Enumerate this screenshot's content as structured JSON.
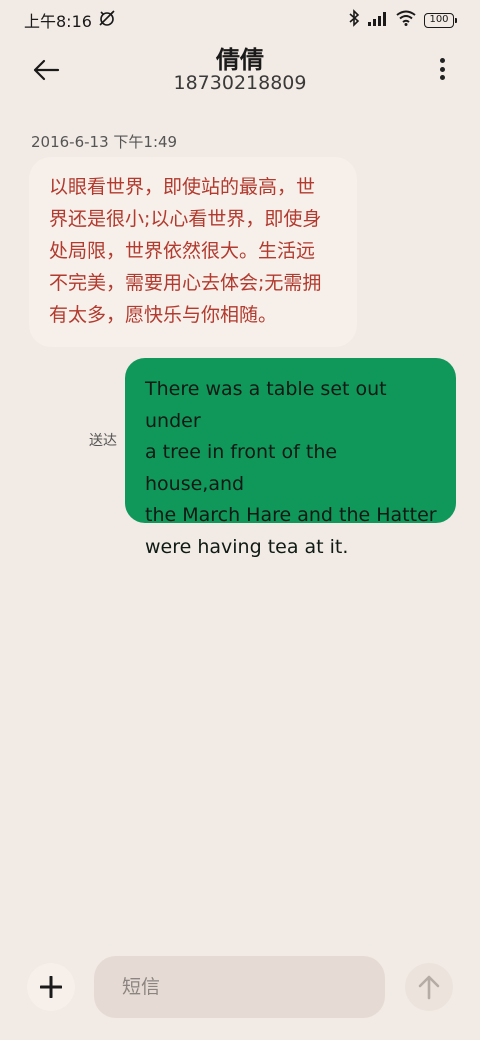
{
  "status_bar": {
    "time": "上午8:16",
    "battery": "100",
    "icons": [
      "alarm-off-icon",
      "bluetooth-icon",
      "signal-icon",
      "wifi-icon",
      "battery-icon"
    ]
  },
  "header": {
    "contact_name": "倩倩",
    "phone_number": "18730218809",
    "back_icon": "arrow-left-icon",
    "more_icon": "more-vertical-icon"
  },
  "conversation": {
    "timestamp": "2016-6-13 下午1:49",
    "messages": [
      {
        "direction": "incoming",
        "lines": [
          "以眼看世界，即使站的最高，世",
          "界还是很小;以心看世界，即使身",
          "处局限，世界依然很大。生活远",
          "不完美，需要用心去体会;无需拥",
          "有太多，愿快乐与你相随。"
        ],
        "text_color": "#b23a2e"
      },
      {
        "direction": "outgoing",
        "status": "送达",
        "lines": [
          "There was a table set out under",
          "a tree in front of the house,and",
          "the March Hare and the Hatter",
          "were having tea at it."
        ],
        "bubble_color": "#10985a"
      }
    ]
  },
  "composer": {
    "placeholder": "短信",
    "value": "",
    "add_icon": "plus-icon",
    "send_icon": "arrow-up-icon"
  },
  "colors": {
    "background": "#f2eae4",
    "incoming_bubble": "#f6efea",
    "outgoing_bubble": "#10985a",
    "incoming_text": "#b23a2e"
  }
}
